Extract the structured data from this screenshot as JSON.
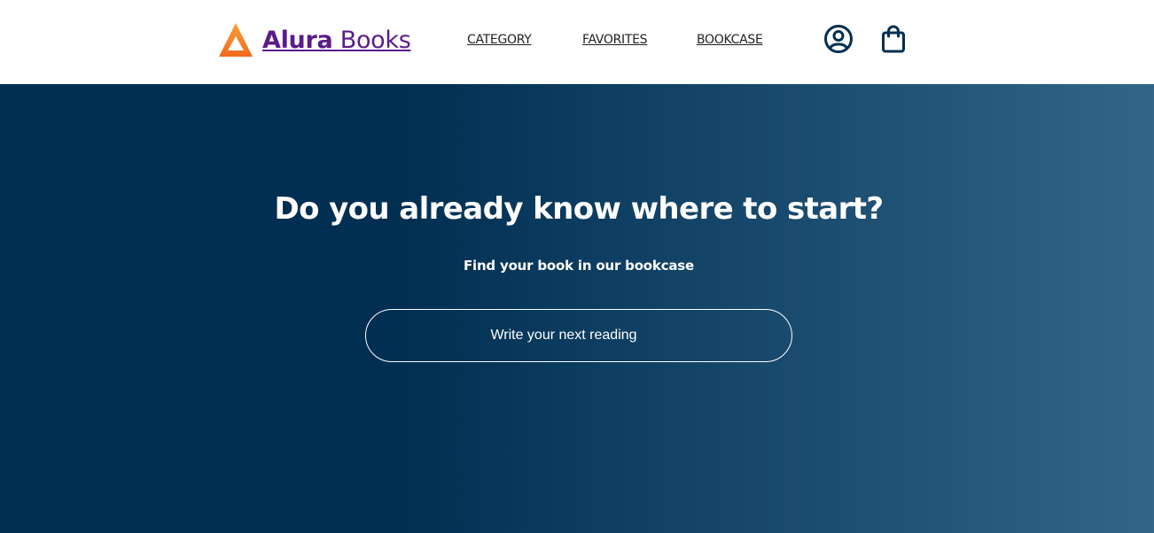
{
  "brand": {
    "name_bold": "Alura",
    "name_light": "Books",
    "color": "#5a1b8c",
    "logo_color": "#f47b20",
    "logo_icon": "triangle-logo-icon"
  },
  "nav": {
    "items": [
      {
        "label": "CATEGORY"
      },
      {
        "label": "FAVORITES"
      },
      {
        "label": "BOOKCASE"
      }
    ]
  },
  "header_icons": {
    "profile": "user-circle-icon",
    "bag": "shopping-bag-icon",
    "color": "#002f52"
  },
  "hero": {
    "title": "Do you already know where to start?",
    "subtitle": "Find your book in our bookcase",
    "search_placeholder": "Write your next reading",
    "search_value": "",
    "gradient_start": "#002f52",
    "gradient_end": "#326589"
  }
}
